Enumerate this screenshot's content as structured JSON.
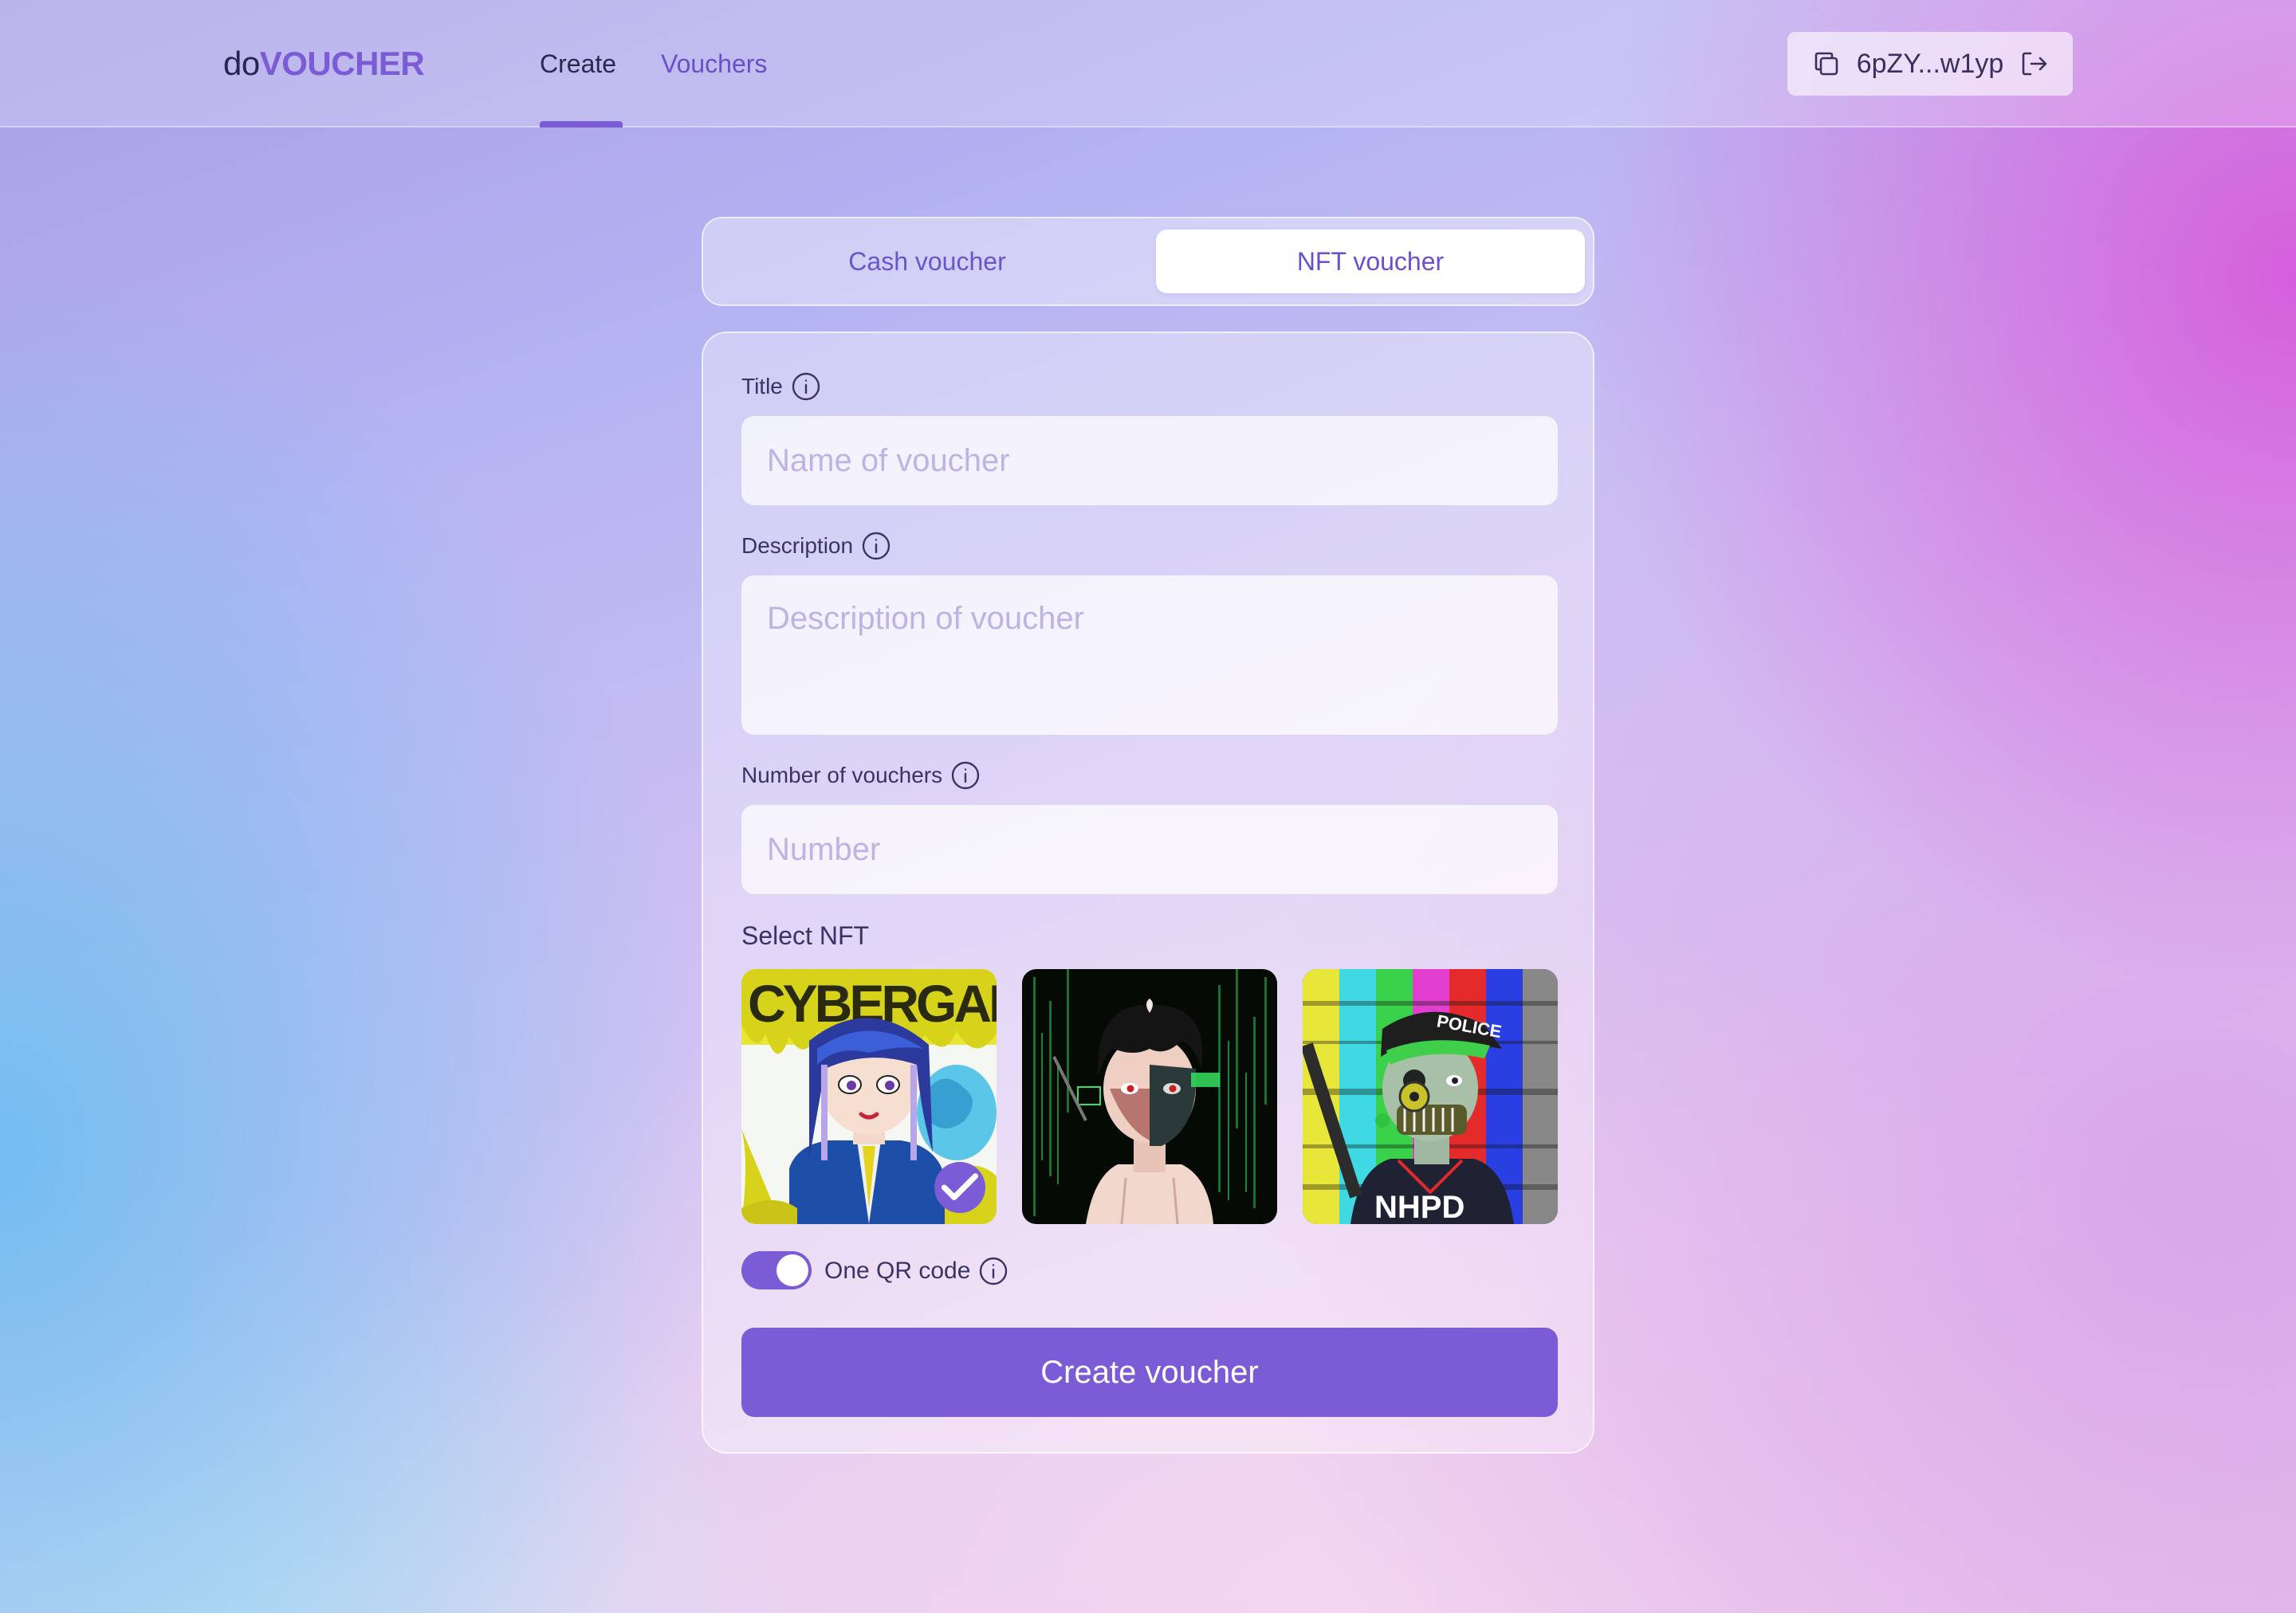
{
  "header": {
    "logo_prefix": "do",
    "logo_main": "VOUCHER",
    "nav": {
      "create": "Create",
      "vouchers": "Vouchers",
      "active": "create"
    },
    "wallet": {
      "address": "6pZY...w1yp",
      "copy_icon": "copy-icon",
      "logout_icon": "logout-icon"
    }
  },
  "voucher_type": {
    "cash_label": "Cash voucher",
    "nft_label": "NFT voucher",
    "selected": "nft"
  },
  "form": {
    "title": {
      "label": "Title",
      "placeholder": "Name of voucher",
      "value": ""
    },
    "description": {
      "label": "Description",
      "placeholder": "Description of voucher",
      "value": ""
    },
    "number": {
      "label": "Number of vouchers",
      "placeholder": "Number",
      "value": ""
    },
    "select_nft_label": "Select NFT",
    "nfts": [
      {
        "name": "Cybergalz anime character",
        "selected": true
      },
      {
        "name": "Masked dark-haired character",
        "selected": false
      },
      {
        "name": "Police character with gas mask",
        "selected": false
      }
    ],
    "one_qr": {
      "label": "One QR code",
      "enabled": true
    },
    "submit_label": "Create voucher"
  },
  "colors": {
    "accent": "#7b5bd6",
    "text_dark": "#3b3366",
    "placeholder": "#bfb3e4"
  }
}
